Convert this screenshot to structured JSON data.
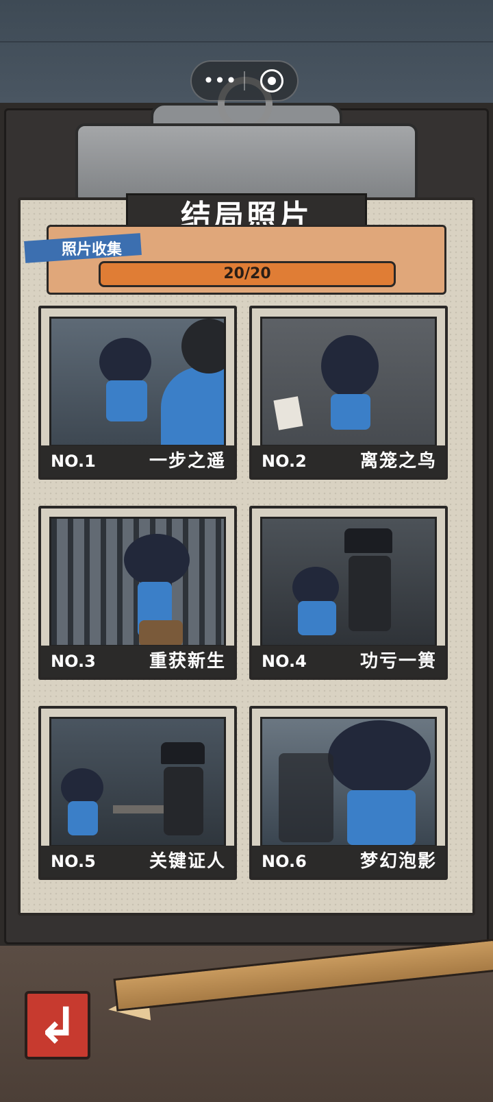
{
  "header": {
    "title": "结局照片"
  },
  "collection": {
    "label": "照片收集",
    "progress_text": "20/20",
    "collected": 20,
    "total": 20,
    "fill_color": "#e07d35"
  },
  "capsule": {
    "more_icon": "more-dots-icon",
    "close_icon": "target-icon"
  },
  "endings": [
    {
      "no": "NO.1",
      "title": "一步之遥"
    },
    {
      "no": "NO.2",
      "title": "离笼之鸟"
    },
    {
      "no": "NO.3",
      "title": "重获新生"
    },
    {
      "no": "NO.4",
      "title": "功亏一篑"
    },
    {
      "no": "NO.5",
      "title": "关键证人"
    },
    {
      "no": "NO.6",
      "title": "梦幻泡影"
    }
  ],
  "footer": {
    "back_icon": "back-arrow-icon"
  }
}
